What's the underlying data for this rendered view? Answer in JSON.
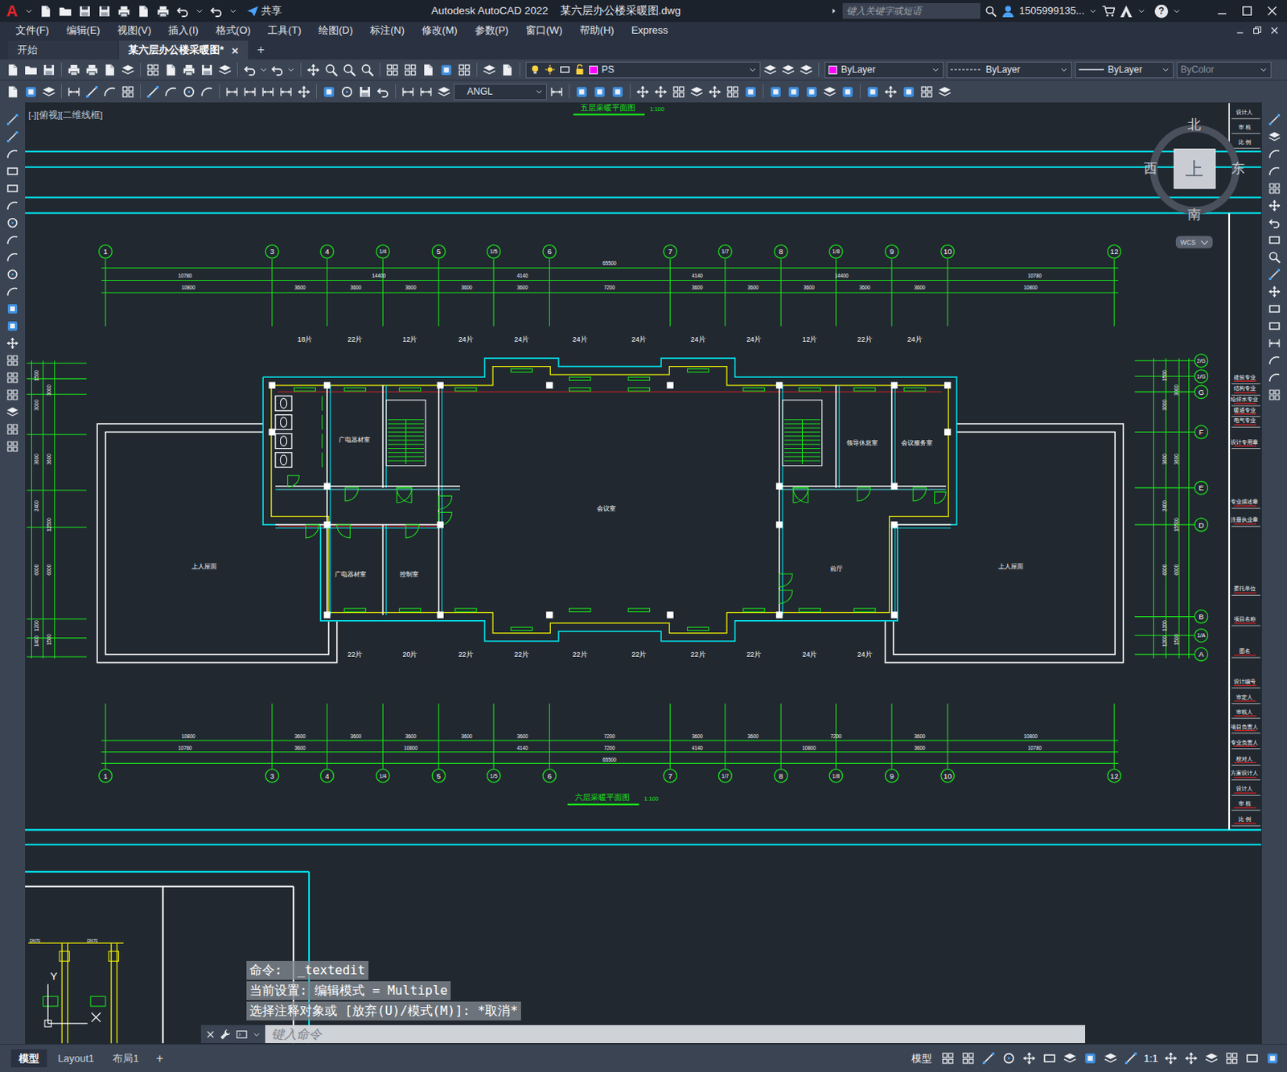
{
  "app": {
    "logo": "A",
    "title": "Autodesk AutoCAD 2022    某六层办公楼采暖图.dwg",
    "share": "共享",
    "search_placeholder": "键入关键字或短语",
    "user": "1505999135...",
    "help": "?"
  },
  "menu": [
    "文件(F)",
    "编辑(E)",
    "视图(V)",
    "插入(I)",
    "格式(O)",
    "工具(T)",
    "绘图(D)",
    "标注(N)",
    "修改(M)",
    "参数(P)",
    "窗口(W)",
    "帮助(H)",
    "Express"
  ],
  "doc_tabs": [
    {
      "label": "开始",
      "selected": false,
      "closable": false
    },
    {
      "label": "某六层办公楼采暖图*",
      "selected": true,
      "closable": true
    }
  ],
  "doc_tab_close": "×",
  "doc_tab_new": "+",
  "properties": {
    "layer": "PS",
    "layer_color": "#ff00ff",
    "color": "ByLayer",
    "color_swatch": "#ff00ff",
    "linetype": "ByLayer",
    "lineweight": "ByLayer",
    "plotstyle": "ByColor",
    "plotstyle_disabled": true,
    "dimstyle": "ANGL"
  },
  "viewport_label": "[-][俯视][二维线框]",
  "viewcube": {
    "north": "北",
    "south": "南",
    "east": "东",
    "west": "西",
    "top": "上",
    "wcs": "WCS"
  },
  "drawing": {
    "titles": [
      {
        "name": "五层采暖平面图",
        "scale": "1:100"
      },
      {
        "name": "六层采暖平面图",
        "scale": "1:100"
      }
    ],
    "column_axes": [
      "1",
      "3",
      "4",
      "1/4",
      "5",
      "1/5",
      "6",
      "7",
      "1/7",
      "8",
      "1/8",
      "9",
      "10",
      "12"
    ],
    "row_axes": [
      "2/G",
      "1/G",
      "G",
      "F",
      "E",
      "D",
      "B",
      "1/A",
      "A"
    ],
    "top_dims": {
      "total": "65500",
      "row1": [
        "10780",
        "14400",
        "4140",
        "4140",
        "14400",
        "10780"
      ],
      "row2": [
        "10800",
        "3600",
        "3600",
        "3600",
        "3600",
        "3600",
        "7200",
        "3600",
        "3600",
        "3600",
        "3600",
        "3600",
        "10800"
      ]
    },
    "bottom_dims": {
      "row1": [
        "10800",
        "3600",
        "3600",
        "3600",
        "3600",
        "3600",
        "7200",
        "3600",
        "3600",
        "7200",
        "3600",
        "10800"
      ],
      "row2": [
        "10780",
        "3600",
        "10800",
        "4140",
        "7200",
        "4140",
        "10800",
        "3600",
        "10780"
      ],
      "total": "65500"
    },
    "left_dims": {
      "outer": [
        "1500",
        "3000",
        "3600",
        "2400",
        "6000",
        "1200",
        "1400"
      ],
      "inner": [
        "3000",
        "3600",
        "12500",
        "6000",
        "1500"
      ]
    },
    "right_dims": {
      "outer": [
        "1500",
        "3000",
        "3600",
        "2400",
        "6000",
        "1200",
        "1200"
      ],
      "inner": [
        "3000",
        "3600",
        "15500",
        "6000",
        "1500"
      ]
    },
    "radiators_top": [
      "18片",
      "22片",
      "12片",
      "24片",
      "24片",
      "24片",
      "24片",
      "24片",
      "24片",
      "12片",
      "22片",
      "24片"
    ],
    "radiators_bottom": [
      "22片",
      "20片",
      "22片",
      "22片",
      "22片",
      "22片",
      "22片",
      "22片",
      "24片",
      "24片"
    ],
    "rooms": [
      "广电器材室",
      "会议室",
      "领导休息室",
      "会议服务室",
      "广电器材室",
      "控制室",
      "前厅",
      "上人屋面",
      "上人屋面"
    ],
    "title_block_top": [
      "设计人",
      "审 核",
      "比 例"
    ],
    "title_block": [
      "建筑专业",
      "结构专业",
      "给排水专业",
      "暖通专业",
      "电气专业",
      "设计专用章",
      "专业描述章",
      "注册执业章",
      "委托单位",
      "项目名称",
      "图名",
      "设计编号",
      "审定人",
      "审核人",
      "项目负责人",
      "专业负责人",
      "校对人",
      "方案设计人",
      "设计人",
      "审 核",
      "比 例"
    ],
    "detail_labels": [
      "DN70",
      "DN70",
      "Y"
    ]
  },
  "command": {
    "history": [
      "命令:  _textedit",
      "当前设置: 编辑模式 = Multiple",
      "选择注释对象或 [放弃(U)/模式(M)]: *取消*"
    ],
    "placeholder": "键入命令"
  },
  "layout_tabs": [
    {
      "label": "模型",
      "selected": true
    },
    {
      "label": "Layout1",
      "selected": false
    },
    {
      "label": "布局1",
      "selected": false
    }
  ],
  "layout_tab_new": "+",
  "status_bar": {
    "mode": "模型",
    "scale": "1:1"
  }
}
